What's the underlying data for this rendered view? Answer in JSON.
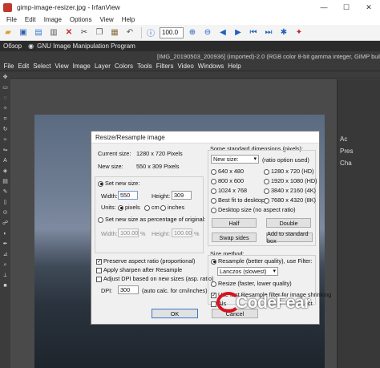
{
  "window": {
    "title": "gimp-image-resizer.jpg - IrfanView",
    "min": "—",
    "max": "☐",
    "close": "✕"
  },
  "menu": [
    "File",
    "Edit",
    "Image",
    "Options",
    "View",
    "Help"
  ],
  "toolbar": {
    "zoom_value": "100.0",
    "icons": [
      "open-folder-icon",
      "save-icon",
      "slideshow-icon",
      "print-icon",
      "delete-icon",
      "cut-icon",
      "copy-icon",
      "paste-icon",
      "undo-icon",
      "info-icon",
      "zoom-in-icon",
      "zoom-out-icon",
      "previous-icon",
      "next-icon",
      "first-icon",
      "last-icon",
      "settings-icon",
      "irfanview-logo-icon"
    ]
  },
  "gimp": {
    "left_title": "Обзор",
    "title": "GNU Image Manipulation Program",
    "subtitle": "[IMG_20190503_200936] (imported)-2.0 (RGB color 8-bit gamma integer, GIMP built-in sRGB",
    "menu": [
      "File",
      "Edit",
      "Select",
      "View",
      "Image",
      "Layer",
      "Colors",
      "Tools",
      "Filters",
      "Video",
      "Windows",
      "Help"
    ],
    "dock_top": "Ac",
    "dock_mid": "Pres",
    "dock_chan": "Cha"
  },
  "dialog": {
    "title": "Resize/Resample image",
    "current_size_label": "Current size:",
    "current_size_value": "1280 x 720  Pixels",
    "new_size_label": "New size:",
    "new_size_value": "550 x 309  Pixels",
    "set_new_size": "Set new size:",
    "width_label": "Width:",
    "width_value": "550",
    "height_label": "Height:",
    "height_value": "309",
    "units_label": "Units:",
    "unit_pixels": "pixels",
    "unit_cm": "cm",
    "unit_inches": "inches",
    "set_percentage": "Set new size as percentage of original:",
    "pct_width_label": "Width:",
    "pct_width_value": "100.00",
    "pct_height_label": "Height:",
    "pct_height_value": "100.00",
    "pct_sign": "%",
    "preserve_aspect": "Preserve aspect ratio (proportional)",
    "apply_sharpen": "Apply sharpen after Resample",
    "adjust_dpi": "Adjust DPI based on new sizes (asp. ratio)",
    "dpi_label": "DPI:",
    "dpi_value": "300",
    "dpi_hint": "(auto calc. for cm/inches)",
    "ok": "OK",
    "cancel": "Cancel",
    "standard_dims_label": "Some standard dimensions (pixels):",
    "new_size_select": "New size:",
    "ratio_hint": "(ratio option used)",
    "dims": [
      {
        "label": "640 x 480",
        "hint": ""
      },
      {
        "label": "1280 x 720",
        "hint": "(HD)"
      },
      {
        "label": "800 x 600",
        "hint": ""
      },
      {
        "label": "1920 x 1080",
        "hint": "(HD)"
      },
      {
        "label": "1024 x 768",
        "hint": ""
      },
      {
        "label": "3840 x 2160",
        "hint": "(4K)"
      },
      {
        "label": "Best fit to desktop",
        "hint": ""
      },
      {
        "label": "7680 x 4320",
        "hint": "(8K)"
      }
    ],
    "desktop_size": "Desktop size (no aspect ratio)",
    "half": "Half",
    "double": "Double",
    "swap_sides": "Swap sides",
    "add_standard": "Add to standard box",
    "size_method": "Size method:",
    "resample": "Resample (better quality), use Filter:",
    "filter_value": "Lanczos (slowest)",
    "resize_fast": "Resize (faster, lower quality)",
    "fast_resample": "Use fast Resample filter for image shrinking",
    "preserve_tail": "preserve",
    "also": "Als",
    "ect": "ect"
  },
  "watermark": {
    "text": "CodeFear"
  },
  "colors": {
    "gimp_bg": "#454545",
    "dialog_bg": "#f0f0f0",
    "logo_red": "#d8141c",
    "accent": "#3a78c9"
  }
}
